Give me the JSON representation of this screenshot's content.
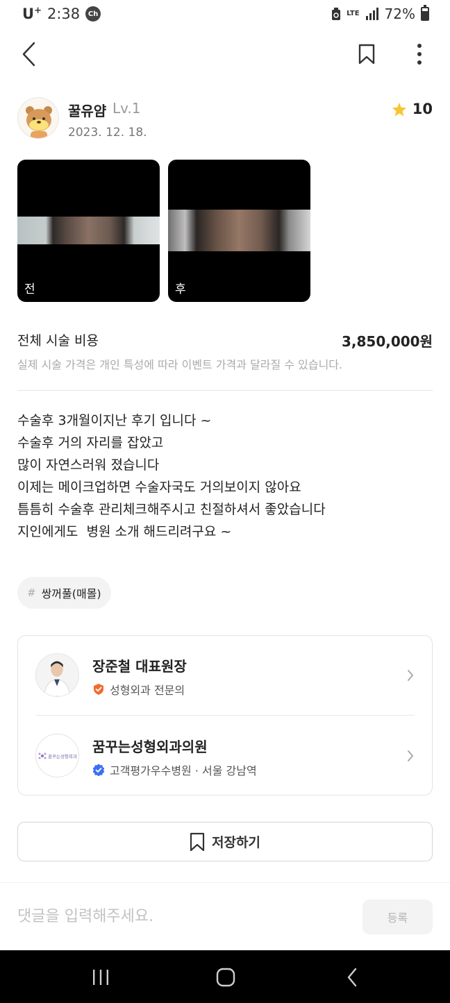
{
  "status_bar": {
    "carrier": "U",
    "carrier_plus": "+",
    "time": "2:38",
    "ch_badge": "Ch",
    "network": "LTE",
    "battery": "72%"
  },
  "toolbar": {
    "back_icon": "back-arrow-icon",
    "bookmark_icon": "bookmark-icon",
    "more_icon": "more-vertical-icon"
  },
  "author": {
    "name": "꿀유얌",
    "level": "Lv.1",
    "date": "2023. 12. 18.",
    "rating": "10",
    "avatar_icon": "bear-avatar-icon"
  },
  "photos": [
    {
      "label": "전"
    },
    {
      "label": "후"
    }
  ],
  "cost": {
    "label": "전체 시술 비용",
    "value": "3,850,000원",
    "note": "실제 시술 가격은 개인 특성에 따라 이벤트 가격과 달라질 수 있습니다."
  },
  "review": {
    "lines": [
      "수술후 3개월이지난 후기 입니다 ~",
      "수술후 거의 자리를 잡았고",
      "많이 자연스러워 졌습니다",
      "이제는 메이크업하면 수술자국도 거의보이지 않아요",
      "틈틈히 수술후 관리체크해주시고 친절하셔서 좋았습니다",
      "지인에게도  병원 소개 해드리려구요 ~"
    ]
  },
  "tags": [
    {
      "hash": "#",
      "label": "쌍꺼풀(매몰)"
    }
  ],
  "doctor": {
    "name": "장준철 대표원장",
    "specialty": "성형외과 전문의",
    "badge_color": "#f26b2e"
  },
  "clinic": {
    "name": "꿈꾸는성형외과의원",
    "logo_text": "꿈꾸는성형외과",
    "subtitle": "고객평가우수병원 · 서울 강남역",
    "badge_color": "#3d6ff5"
  },
  "save_button": {
    "label": "저장하기"
  },
  "comment": {
    "placeholder": "댓글을 입력해주세요.",
    "submit_label": "등록"
  },
  "colors": {
    "star": "#f7c531",
    "text": "#222222",
    "muted": "#aaaaaa"
  }
}
